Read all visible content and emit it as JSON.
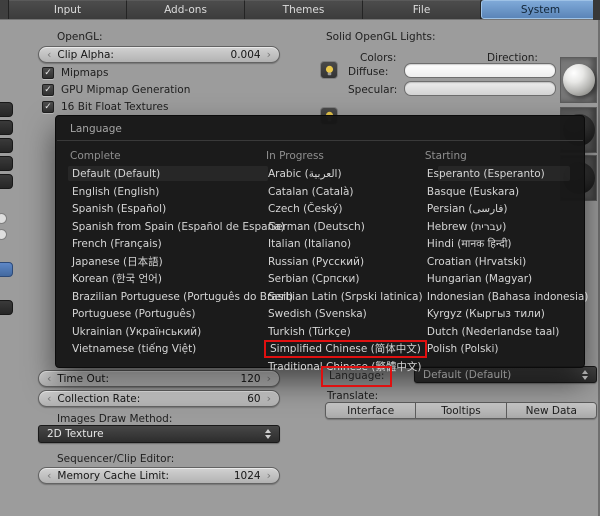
{
  "colors": {
    "active_tab": "#6a9bd2",
    "annotation": "#e01010"
  },
  "tabs": [
    {
      "label": "Input",
      "active": false
    },
    {
      "label": "Add-ons",
      "active": false
    },
    {
      "label": "Themes",
      "active": false
    },
    {
      "label": "File",
      "active": false
    },
    {
      "label": "System",
      "active": true
    }
  ],
  "opengl": {
    "section_label": "OpenGL:",
    "clip_alpha": {
      "label": "Clip Alpha:",
      "value": "0.004"
    },
    "checkboxes": [
      {
        "label": "Mipmaps",
        "checked": true
      },
      {
        "label": "GPU Mipmap Generation",
        "checked": true
      },
      {
        "label": "16 Bit Float Textures",
        "checked": true
      }
    ]
  },
  "solid_lights": {
    "section_label": "Solid OpenGL Lights:",
    "colors_label": "Colors:",
    "direction_label": "Direction:",
    "diffuse_label": "Diffuse:",
    "specular_label": "Specular:"
  },
  "language_menu": {
    "title": "Language",
    "highlighted_item": "Simplified Chinese (简体中文)",
    "columns": [
      {
        "header": "Complete",
        "items": [
          "Default (Default)",
          "English (English)",
          "Spanish (Español)",
          "Spanish from Spain (Español de España)",
          "French (Français)",
          "Japanese (日本語)",
          "Korean (한국 언어)",
          "Brazilian Portuguese (Português do Brasil)",
          "Portuguese (Português)",
          "Ukrainian (Український)",
          "Vietnamese (tiếng Việt)"
        ]
      },
      {
        "header": "In Progress",
        "items": [
          "Arabic (العربية)",
          "Catalan (Català)",
          "Czech (Český)",
          "German (Deutsch)",
          "Italian (Italiano)",
          "Russian (Русский)",
          "Serbian (Српски)",
          "Serbian Latin (Srpski latinica)",
          "Swedish (Svenska)",
          "Turkish (Türkçe)",
          "Simplified Chinese (简体中文)",
          "Traditional Chinese (繁體中文)"
        ]
      },
      {
        "header": "Starting",
        "items": [
          "Esperanto (Esperanto)",
          "Basque (Euskara)",
          "Persian (فارسى)",
          "Hebrew (עברית)",
          "Hindi (मानक हिन्दी)",
          "Croatian (Hrvatski)",
          "Hungarian (Magyar)",
          "Indonesian (Bahasa indonesia)",
          "Kyrgyz (Кыргыз тили)",
          "Dutch (Nederlandse taal)",
          "Polish (Polski)"
        ]
      }
    ]
  },
  "left_settings": {
    "time_out": {
      "label": "Time Out:",
      "value": "120"
    },
    "collection_rate": {
      "label": "Collection Rate:",
      "value": "60"
    },
    "images_draw_method_label": "Images Draw Method:",
    "images_draw_method_value": "2D Texture",
    "sequencer_label": "Sequencer/Clip Editor:",
    "memory_cache": {
      "label": "Memory Cache Limit:",
      "value": "1024"
    }
  },
  "international": {
    "language_label": "Language:",
    "language_value": "Default (Default)",
    "translate_label": "Translate:",
    "buttons": [
      "Interface",
      "Tooltips",
      "New Data"
    ]
  }
}
